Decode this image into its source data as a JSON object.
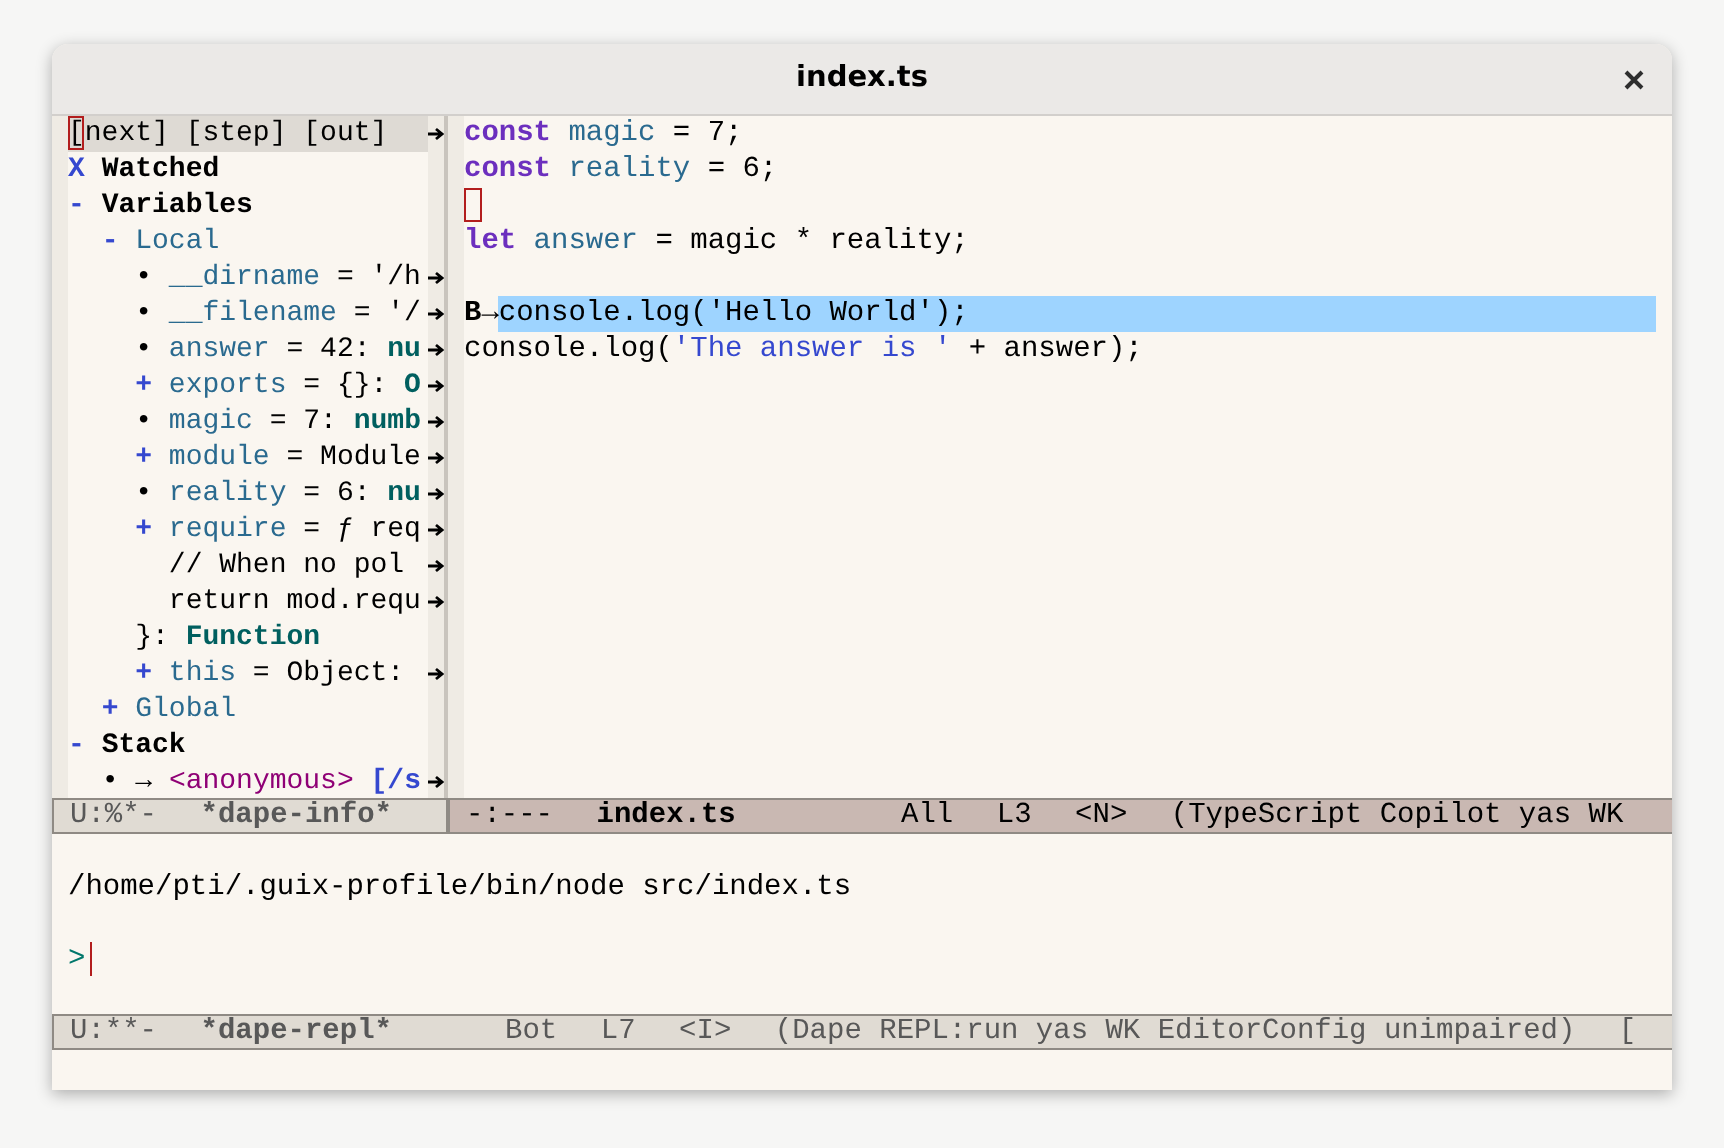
{
  "window": {
    "title": "index.ts"
  },
  "info_pane": {
    "header_truncated": true,
    "header_buttons": [
      {
        "label": "[next]",
        "cursor": true
      },
      {
        "label": "[step]",
        "cursor": false
      },
      {
        "label": "[out]",
        "cursor": false
      }
    ],
    "tree": [
      {
        "marker": "X",
        "kind": "toggle",
        "truncated": false,
        "parts": [
          {
            "text": "Watched",
            "kind": "heading"
          }
        ]
      },
      {
        "marker": "-",
        "kind": "toggle",
        "truncated": false,
        "parts": [
          {
            "text": "Variables",
            "kind": "heading"
          }
        ],
        "children": [
          {
            "marker": "-",
            "kind": "toggle",
            "truncated": false,
            "parts": [
              {
                "text": "Local",
                "kind": "variable"
              }
            ],
            "children": [
              {
                "marker": "•",
                "kind": "bullet",
                "truncated": true,
                "parts": [
                  {
                    "text": "__dirname",
                    "kind": "variable"
                  },
                  {
                    "text": " = '/h",
                    "kind": "plain"
                  }
                ]
              },
              {
                "marker": "•",
                "kind": "bullet",
                "truncated": true,
                "parts": [
                  {
                    "text": "__filename",
                    "kind": "variable"
                  },
                  {
                    "text": " = '/",
                    "kind": "plain"
                  }
                ]
              },
              {
                "marker": "•",
                "kind": "bullet",
                "truncated": true,
                "parts": [
                  {
                    "text": "answer",
                    "kind": "variable"
                  },
                  {
                    "text": " = 42: ",
                    "kind": "plain"
                  },
                  {
                    "text": "nu",
                    "kind": "type"
                  }
                ]
              },
              {
                "marker": "+",
                "kind": "toggle",
                "truncated": true,
                "parts": [
                  {
                    "text": "exports",
                    "kind": "variable"
                  },
                  {
                    "text": " = {}: ",
                    "kind": "plain"
                  },
                  {
                    "text": "O",
                    "kind": "type"
                  }
                ]
              },
              {
                "marker": "•",
                "kind": "bullet",
                "truncated": true,
                "parts": [
                  {
                    "text": "magic",
                    "kind": "variable"
                  },
                  {
                    "text": " = 7: ",
                    "kind": "plain"
                  },
                  {
                    "text": "numb",
                    "kind": "type"
                  }
                ]
              },
              {
                "marker": "+",
                "kind": "toggle",
                "truncated": true,
                "parts": [
                  {
                    "text": "module",
                    "kind": "variable"
                  },
                  {
                    "text": " = Module",
                    "kind": "plain"
                  }
                ]
              },
              {
                "marker": "•",
                "kind": "bullet",
                "truncated": true,
                "parts": [
                  {
                    "text": "reality",
                    "kind": "variable"
                  },
                  {
                    "text": " = 6: ",
                    "kind": "plain"
                  },
                  {
                    "text": "nu",
                    "kind": "type"
                  }
                ]
              },
              {
                "marker": "+",
                "kind": "toggle",
                "truncated": true,
                "parts": [
                  {
                    "text": "require",
                    "kind": "variable"
                  },
                  {
                    "text": " = ƒ req",
                    "kind": "plain"
                  }
                ],
                "more_lines": [
                  {
                    "truncated": true,
                    "parts": [
                      {
                        "text": "  // When no pol",
                        "kind": "plain"
                      }
                    ]
                  },
                  {
                    "truncated": true,
                    "parts": [
                      {
                        "text": "  return mod.requ",
                        "kind": "plain"
                      }
                    ]
                  },
                  {
                    "truncated": false,
                    "parts": [
                      {
                        "text": "}: ",
                        "kind": "plain"
                      },
                      {
                        "text": "Function",
                        "kind": "type"
                      }
                    ]
                  }
                ]
              },
              {
                "marker": "+",
                "kind": "toggle",
                "truncated": true,
                "parts": [
                  {
                    "text": "this",
                    "kind": "variable"
                  },
                  {
                    "text": " = Object: ",
                    "kind": "plain"
                  }
                ]
              }
            ]
          },
          {
            "marker": "+",
            "kind": "toggle",
            "truncated": false,
            "parts": [
              {
                "text": "Global",
                "kind": "variable"
              }
            ]
          }
        ]
      },
      {
        "marker": "-",
        "kind": "toggle",
        "truncated": false,
        "parts": [
          {
            "text": "Stack",
            "kind": "heading"
          }
        ],
        "children": [
          {
            "marker": "•",
            "kind": "bullet",
            "truncated": true,
            "parts": [
              {
                "text": "→ ",
                "kind": "plain"
              },
              {
                "text": "<anonymous>",
                "kind": "frame"
              },
              {
                "text": " [/s",
                "kind": "path"
              }
            ]
          }
        ]
      }
    ]
  },
  "editor": {
    "lines": [
      {
        "cursor": false,
        "highlighted": false,
        "parts": [
          {
            "text": "const",
            "kind": "keyword"
          },
          {
            "text": "magic",
            "kind": "variable"
          },
          {
            "text": " = 7;",
            "kind": "plain"
          }
        ]
      },
      {
        "cursor": false,
        "highlighted": false,
        "parts": [
          {
            "text": "const",
            "kind": "keyword"
          },
          {
            "text": "reality",
            "kind": "variable"
          },
          {
            "text": " = 6;",
            "kind": "plain"
          }
        ]
      },
      {
        "cursor": true,
        "highlighted": false
      },
      {
        "cursor": false,
        "highlighted": false,
        "parts": [
          {
            "text": "let",
            "kind": "keyword"
          },
          {
            "text": "answer",
            "kind": "variable"
          },
          {
            "text": " = magic * reality;",
            "kind": "plain"
          }
        ]
      },
      {
        "cursor": false,
        "highlighted": false
      },
      {
        "cursor": false,
        "highlighted": true,
        "margin": "B→",
        "parts": [
          {
            "text": "console.log('Hello World');",
            "kind": "plain"
          }
        ]
      },
      {
        "cursor": false,
        "highlighted": false,
        "parts": [
          {
            "text": "console.log(",
            "kind": "plain"
          },
          {
            "text": "'The answer is '",
            "kind": "string"
          },
          {
            "text": " + answer);",
            "kind": "plain"
          }
        ]
      }
    ]
  },
  "mode_lines": [
    {
      "active": false,
      "segments": [
        {
          "text": "U:%*-",
          "kind": "state"
        },
        {
          "text": "*dape-info*",
          "kind": "buffer"
        }
      ]
    },
    {
      "active": true,
      "segments": [
        {
          "text": "-:---",
          "kind": "state"
        },
        {
          "text": "index.ts",
          "kind": "buffer"
        },
        {
          "text": "All",
          "kind": "info"
        },
        {
          "text": "L3",
          "kind": "info"
        },
        {
          "text": "<N>",
          "kind": "info"
        },
        {
          "text": "(TypeScript Copilot yas WK",
          "kind": "info"
        }
      ]
    }
  ],
  "repl": {
    "output": "/home/pti/.guix-profile/bin/node src/index.ts",
    "prompt": ">",
    "cursor": true
  },
  "repl_mode_line": {
    "active": false,
    "segments": [
      {
        "text": "U:**-",
        "kind": "state"
      },
      {
        "text": "*dape-repl*",
        "kind": "buffer"
      },
      {
        "text": "Bot",
        "kind": "info"
      },
      {
        "text": "L7",
        "kind": "info"
      },
      {
        "text": "<I>",
        "kind": "info"
      },
      {
        "text": "(Dape REPL:run yas WK EditorConfig unimpaired)",
        "kind": "info"
      },
      {
        "text": "[",
        "kind": "info"
      }
    ]
  }
}
